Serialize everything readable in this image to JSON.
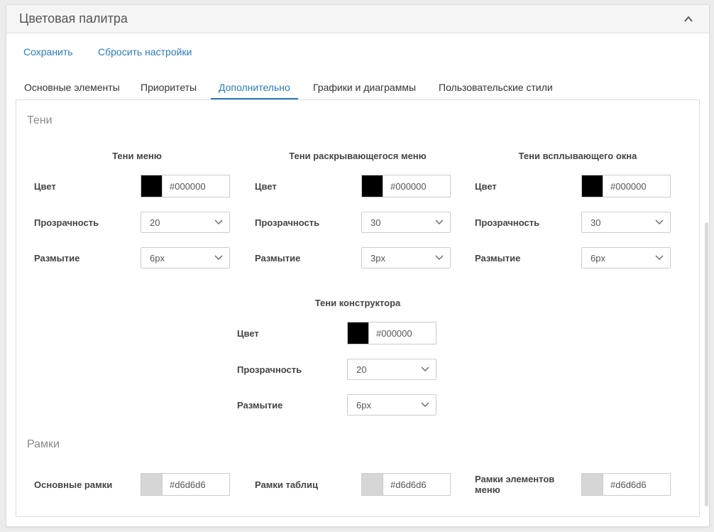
{
  "panel": {
    "title": "Цветовая палитра",
    "collapse_icon": "chevron-up-icon"
  },
  "actions": {
    "save": "Сохранить",
    "reset": "Сбросить настройки"
  },
  "tabs": [
    {
      "label": "Основные элементы"
    },
    {
      "label": "Приоритеты"
    },
    {
      "label": "Дополнительно",
      "active": true
    },
    {
      "label": "Графики и диаграммы"
    },
    {
      "label": "Пользовательские стили"
    }
  ],
  "shadows": {
    "title": "Тени",
    "labels": {
      "color": "Цвет",
      "opacity": "Прозрачность",
      "blur": "Размытие"
    },
    "groups": [
      {
        "title": "Тени меню",
        "color": "#000000",
        "opacity": "20",
        "blur": "6px"
      },
      {
        "title": "Тени раскрывающегося меню",
        "color": "#000000",
        "opacity": "30",
        "blur": "3px"
      },
      {
        "title": "Тени всплывающего окна",
        "color": "#000000",
        "opacity": "30",
        "blur": "6px"
      },
      {
        "title": "Тени конструктора",
        "color": "#000000",
        "opacity": "20",
        "blur": "6px"
      }
    ]
  },
  "borders": {
    "title": "Рамки",
    "items": [
      {
        "label": "Основные рамки",
        "color": "#d6d6d6"
      },
      {
        "label": "Рамки таблиц",
        "color": "#d6d6d6"
      },
      {
        "label": "Рамки элементов меню",
        "color": "#d6d6d6"
      }
    ]
  },
  "colors": {
    "accent": "#2a7bbd",
    "swatch_black": "#000000",
    "swatch_gray": "#d6d6d6"
  }
}
